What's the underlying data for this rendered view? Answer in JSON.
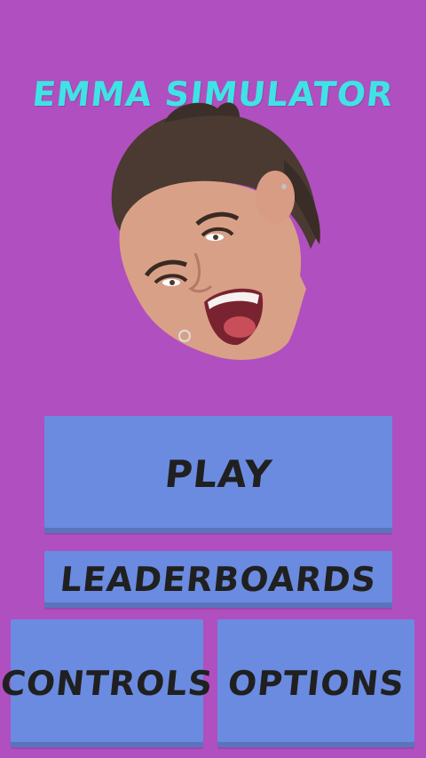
{
  "game": {
    "title": "EMMA SIMULATOR"
  },
  "character": {
    "image": "laughing-face"
  },
  "menu": {
    "play_label": "PLAY",
    "leaderboards_label": "LEADERBOARDS",
    "controls_label": "CONTROLS",
    "options_label": "OPTIONS"
  },
  "colors": {
    "background": "#b04fbf",
    "title": "#3fe3e6",
    "button": "#6a8be0",
    "button_text": "#202020"
  }
}
